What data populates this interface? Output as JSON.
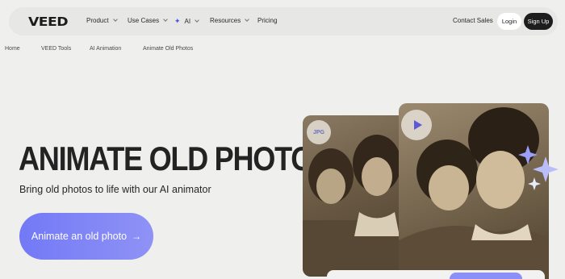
{
  "nav": {
    "logo": "VEED",
    "items": [
      {
        "label": "Product"
      },
      {
        "label": "Use Cases"
      },
      {
        "label": "AI"
      },
      {
        "label": "Resources"
      },
      {
        "label": "Pricing"
      }
    ],
    "contact": "Contact Sales",
    "login": "Login",
    "signup": "Sign Up"
  },
  "breadcrumb": [
    "Home",
    "VEED Tools",
    "AI Animation",
    "Animate Old Photos"
  ],
  "hero": {
    "title": "ANIMATE OLD PHOTOS",
    "subtitle": "Bring old photos to life with our AI animator",
    "cta": "Animate an old photo"
  },
  "media": {
    "badge_left": "JPG"
  },
  "colors": {
    "accent": "#7379f6",
    "dark": "#1d1d1d",
    "background": "#efefed"
  }
}
